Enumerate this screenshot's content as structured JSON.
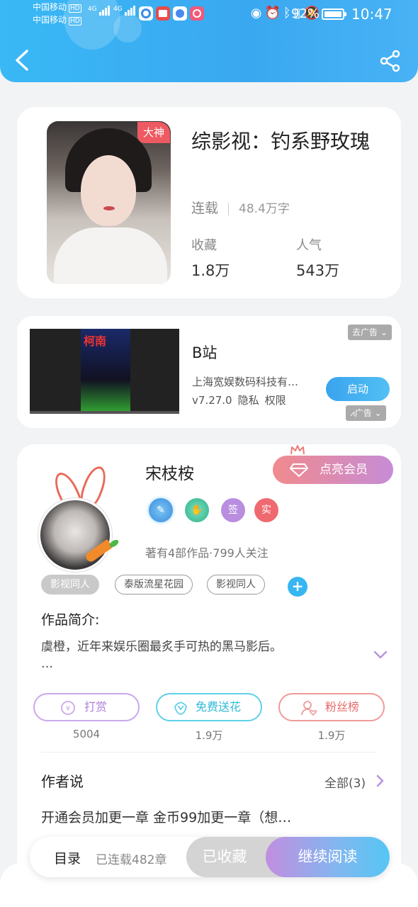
{
  "status_bar": {
    "carrier1": "中国移动",
    "carrier2": "中国移动",
    "hd": "HD",
    "network": "4G",
    "battery": "92%",
    "time": "10:47"
  },
  "book": {
    "badge": "大神",
    "title": "综影视：钓系野玫瑰",
    "status": "连载",
    "words": "48.4万字",
    "favorites_label": "收藏",
    "favorites_value": "1.8万",
    "popularity_label": "人气",
    "popularity_value": "543万"
  },
  "ad": {
    "poster_title": "柯南",
    "go_ad_label": "去广告",
    "app_name": "B站",
    "company": "上海宽娱数码科技有…",
    "version": "v7.27.0",
    "privacy": "隐私",
    "permissions": "权限",
    "start_label": "启动",
    "ad_tag": "广告"
  },
  "author": {
    "name": "宋枝桉",
    "vip_label": "点亮会员",
    "medal_sign": "签",
    "medal_real": "实",
    "stats": "著有4部作品·799人关注",
    "tags": [
      "影视同人",
      "泰版流星花园",
      "影视同人"
    ],
    "add_tag": "+",
    "intro_title": "作品简介:",
    "intro_text": "虞橙，近年来娱乐圈最炙手可热的黑马影后。",
    "intro_more": "…",
    "actions": [
      {
        "label": "打赏",
        "count": "5004",
        "color": "#b794e0"
      },
      {
        "label": "免费送花",
        "count": "1.9万",
        "color": "#3fc3e0"
      },
      {
        "label": "粉丝榜",
        "count": "1.9万",
        "color": "#ee7b7b"
      }
    ],
    "says_title": "作者说",
    "says_all": "全部(3)",
    "says_text": "开通会员加更一章 金币99加更一章（想…"
  },
  "bottom_bar": {
    "toc": "目录",
    "chapters": "已连载482章",
    "collected": "已收藏",
    "continue": "继续阅读"
  },
  "colors": {
    "header_blue": "#3aa8f0",
    "badge_red": "#ee5a62",
    "accent_blue": "#37b6f2"
  }
}
